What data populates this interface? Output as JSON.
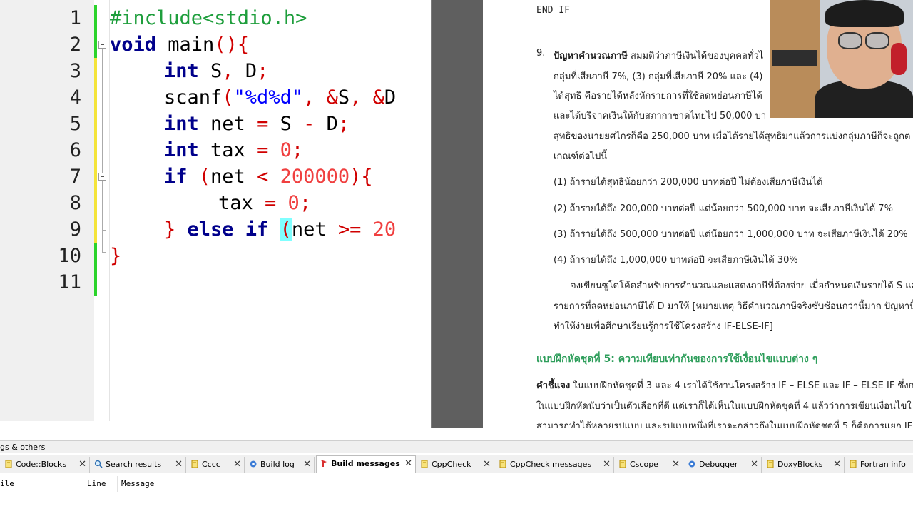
{
  "editor": {
    "lines": [
      {
        "n": "1"
      },
      {
        "n": "2"
      },
      {
        "n": "3"
      },
      {
        "n": "4"
      },
      {
        "n": "5"
      },
      {
        "n": "6"
      },
      {
        "n": "7"
      },
      {
        "n": "8"
      },
      {
        "n": "9"
      },
      {
        "n": "10"
      },
      {
        "n": "11"
      }
    ],
    "code": {
      "l1_pp": "#include<stdio.h>",
      "l2_kw": "void",
      "l2_rest": " main",
      "l2_op": "(){",
      "l3_kw": "int",
      "l3_rest": " S",
      "l3_op1": ",",
      "l3_rest2": " D",
      "l3_op2": ";",
      "l4_fn": "scanf",
      "l4_op1": "(",
      "l4_str": "\"%d%d\"",
      "l4_op2": ", &",
      "l4_id1": "S",
      "l4_op3": ", &",
      "l4_id2": "D",
      "l5_kw": "int",
      "l5_rest": " net ",
      "l5_op1": "=",
      "l5_rest2": " S ",
      "l5_op2": "-",
      "l5_rest3": " D",
      "l5_op3": ";",
      "l6_kw": "int",
      "l6_rest": " tax ",
      "l6_op1": "=",
      "l6_num": " 0",
      "l6_op2": ";",
      "l7_kw": "if",
      "l7_op1": " (",
      "l7_rest": "net ",
      "l7_op2": "<",
      "l7_num": " 200000",
      "l7_op3": "){",
      "l8_rest": "tax ",
      "l8_op1": "=",
      "l8_num": " 0",
      "l8_op2": ";",
      "l9_op1": "}",
      "l9_kw1": " else",
      "l9_kw2": " if",
      "l9_hl": "(",
      "l9_rest": "net ",
      "l9_op2": ">=",
      "l9_num": " 20",
      "l10_op": "}"
    }
  },
  "pdf": {
    "end_if": "END IF",
    "item_num": "9.",
    "item_title": "ปัญหาคำนวณภาษี",
    "p1": "สมมติว่าภาษีเงินได้ของบุคคลทั่วไ",
    "p2": "กลุ่มที่เสียภาษี 7%, (3) กลุ่มที่เสียภาษี 20% และ (4)",
    "p3": "ได้สุทธิ คือรายได้หลังหักรายการที่ใช้ลดหย่อนภาษีได้",
    "p4": "และได้บริจาคเงินให้กับสภากาชาดไทยไป 50,000 บา",
    "p5": "สุทธิของนายยศไกรก็คือ 250,000 บาท  เมื่อได้รายได้สุทธิมาแล้วการแบ่งกลุ่มภาษีก็จะถูกต",
    "p6": "เกณฑ์ต่อไปนี้",
    "c1": "(1) ถ้ารายได้สุทธิน้อยกว่า 200,000 บาทต่อปี ไม่ต้องเสียภาษีเงินได้",
    "c2": "(2) ถ้ารายได้ถึง 200,000 บาทต่อปี แต่น้อยกว่า 500,000 บาท จะเสียภาษีเงินได้ 7%",
    "c3": "(3) ถ้ารายได้ถึง 500,000 บาทต่อปี แต่น้อยกว่า 1,000,000 บาท จะเสียภาษีเงินได้ 20%",
    "c4": "(4) ถ้ารายได้ถึง 1,000,000 บาทต่อปี จะเสียภาษีเงินได้ 30%",
    "q1": "จงเขียนซูโดโค้ดสำหรับการคำนวณและแสดงภาษีที่ต้องจ่าย เมื่อกำหนดเงินรายได้ S และ",
    "q2": "รายการที่ลดหย่อนภาษีได้ D มาให้ [หมายเหตุ วิธีคำนวณภาษีจริงซับซ้อนกว่านี้มาก ปัญหานี้",
    "q3": "ทำให้ง่ายเพื่อศึกษาเรียนรู้การใช้โครงสร้าง IF-ELSE-IF]",
    "section": "แบบฝึกหัดชุดที่ 5: ความเทียบเท่ากันของการใช้เงื่อนไขแบบต่าง ๆ",
    "instr_label": "คำชี้แจง",
    "instr1": " ในแบบฝึกหัดชุดที่ 3 และ 4 เราได้ใช้งานโครงสร้าง IF – ELSE และ IF – ELSE IF ซึ่งก",
    "instr2": "ในแบบฝึกหัดนับว่าเป็นตัวเลือกที่ดี แต่เราก็ได้เห็นในแบบฝึกหัดชุดที่ 4 แล้วว่าการเขียนเงื่อนไขใ",
    "instr3": "สามารถทำได้หลายรูปแบบ  และรูปแบบหนึ่งที่เราจะกล่าวถึงในแบบฝึกหัดชุดที่ 5 ก็คือการแยก IF"
  },
  "panel": {
    "title": "gs & others",
    "tabs": [
      {
        "label": "Code::Blocks",
        "icon": "note-icon"
      },
      {
        "label": "Search results",
        "icon": "search-icon"
      },
      {
        "label": "Cccc",
        "icon": "note-icon"
      },
      {
        "label": "Build log",
        "icon": "gear-icon"
      },
      {
        "label": "Build messages",
        "icon": "marker-icon"
      },
      {
        "label": "CppCheck",
        "icon": "note-icon"
      },
      {
        "label": "CppCheck messages",
        "icon": "note-icon"
      },
      {
        "label": "Cscope",
        "icon": "note-icon"
      },
      {
        "label": "Debugger",
        "icon": "gear-icon"
      },
      {
        "label": "DoxyBlocks",
        "icon": "note-icon"
      },
      {
        "label": "Fortran info",
        "icon": "note-icon"
      }
    ],
    "close_glyph": "✕",
    "columns": [
      "File",
      "Line",
      "Message"
    ],
    "file_col_prefix": "ile"
  }
}
